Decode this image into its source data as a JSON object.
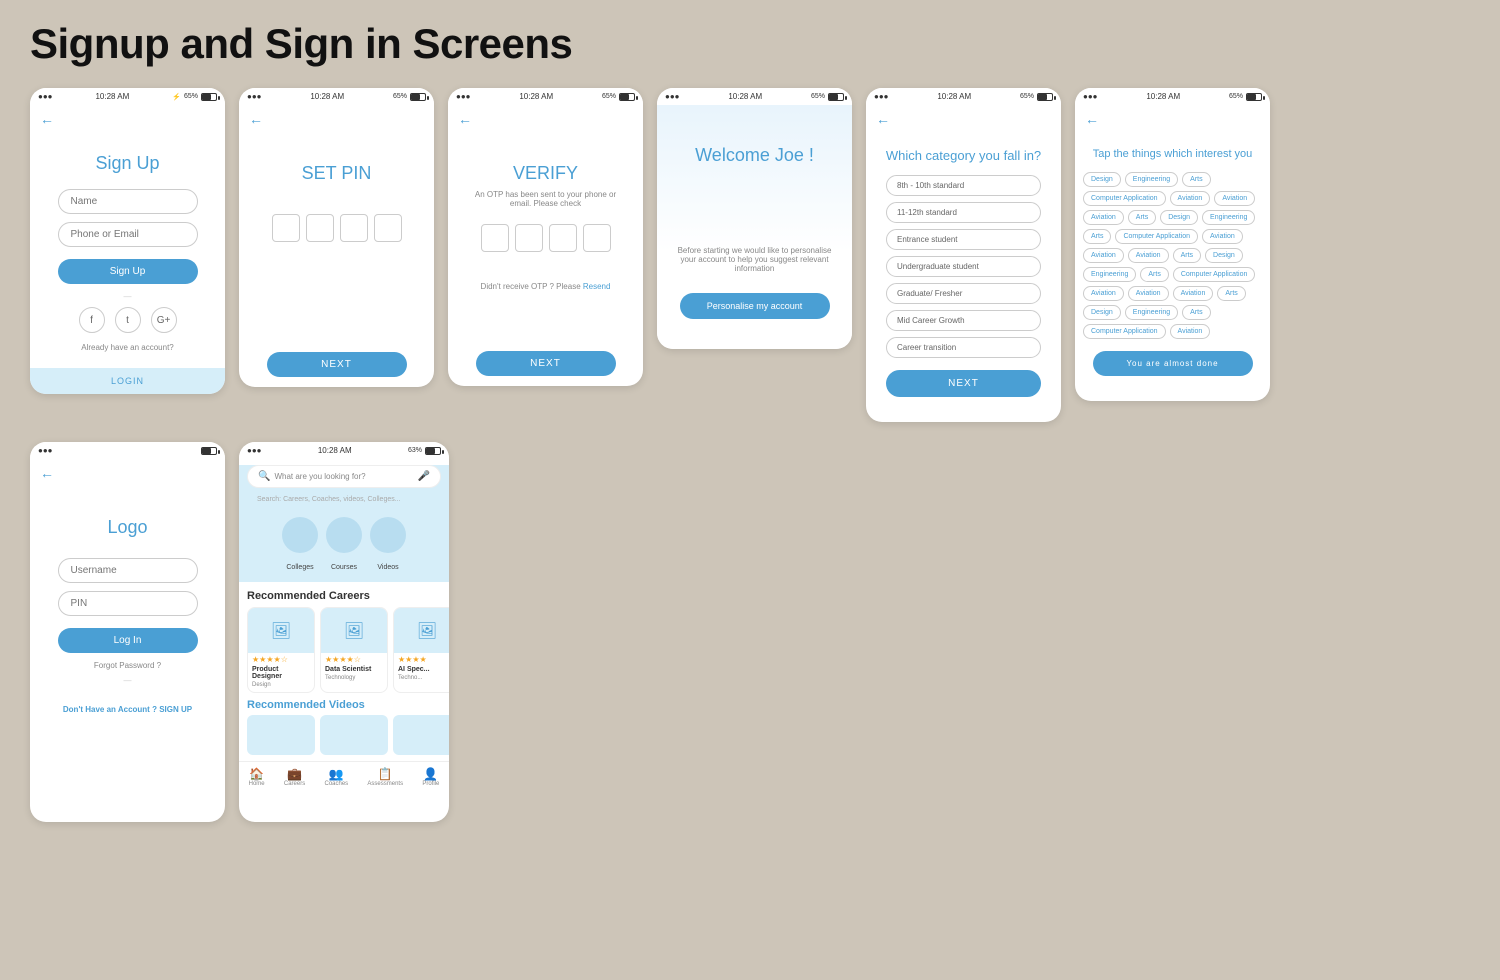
{
  "page": {
    "title": "Signup and Sign in Screens",
    "bg_color": "#cdc5b8"
  },
  "status_bar": {
    "time": "10:28 AM",
    "battery": "65%",
    "signal": "●●●"
  },
  "signup_screen": {
    "back_arrow": "←",
    "title": "Sign Up",
    "name_placeholder": "Name",
    "phone_placeholder": "Phone or Email",
    "btn_label": "Sign Up",
    "divider": "—",
    "social_fb": "f",
    "social_tw": "t",
    "social_gp": "G+",
    "already_text": "Already have an account?",
    "login_label": "LOGIN"
  },
  "setpin_screen": {
    "back_arrow": "←",
    "title": "SET PIN",
    "next_label": "NEXT"
  },
  "verify_screen": {
    "back_arrow": "←",
    "title": "VERIFY",
    "subtitle": "An OTP has been sent to your phone or email. Please check",
    "resend_text": "Didn't receive OTP ? Please",
    "resend_link": "Resend",
    "next_label": "NEXT"
  },
  "welcome_screen": {
    "title": "Welcome Joe !",
    "description": "Before starting we would like to personalise your account to help you suggest relevant information",
    "btn_label": "Personalise my account"
  },
  "category_screen": {
    "back_arrow": "←",
    "title": "Which category you fall in?",
    "categories": [
      "8th - 10th standard",
      "11-12th standard",
      "Entrance student",
      "Undergraduate student",
      "Graduate/ Fresher",
      "Mid Career Growth",
      "Career transition"
    ],
    "next_label": "NEXT"
  },
  "interests_screen": {
    "back_arrow": "←",
    "title": "Tap the things which interest you",
    "tags": [
      "Design",
      "Engineering",
      "Arts",
      "Computer Application",
      "Aviation",
      "Aviation",
      "Aviation",
      "Arts",
      "Design",
      "Engineering",
      "Arts",
      "Computer Application",
      "Aviation",
      "Aviation",
      "Aviation",
      "Arts",
      "Design",
      "Engineering",
      "Arts",
      "Computer Application",
      "Aviation",
      "Aviation",
      "Aviation",
      "Arts",
      "Design",
      "Engineering",
      "Arts",
      "Computer Application",
      "Aviation"
    ],
    "btn_label": "You are almost done"
  },
  "login_screen": {
    "back_arrow": "←",
    "logo": "Logo",
    "username_placeholder": "Username",
    "pin_placeholder": "PIN",
    "btn_label": "Log In",
    "forgot_text": "Forgot Password ?",
    "divider": "—",
    "no_account_text": "Don't Have an Account ?",
    "signup_link": "SIGN UP"
  },
  "home_screen": {
    "status_time": "10:28 AM",
    "status_battery": "63%",
    "search_placeholder": "What are you looking for?",
    "search_hint": "Search: Careers, Coaches, videos, Colleges...",
    "categories": [
      {
        "label": "Colleges"
      },
      {
        "label": "Courses"
      },
      {
        "label": "Videos"
      }
    ],
    "recommended_careers_title": "Recommended Careers",
    "careers": [
      {
        "name": "Product Designer",
        "category": "Design",
        "stars": "★★★★☆"
      },
      {
        "name": "Data Scientist",
        "category": "Technology",
        "stars": "★★★★☆"
      },
      {
        "name": "AI Spec...",
        "category": "Techno...",
        "stars": "★★★★"
      }
    ],
    "recommended_videos_title": "Recommended Videos",
    "nav_items": [
      {
        "label": "Home",
        "active": true
      },
      {
        "label": "Careers"
      },
      {
        "label": "Coaches"
      },
      {
        "label": "Assessments"
      },
      {
        "label": "Profile"
      }
    ]
  }
}
